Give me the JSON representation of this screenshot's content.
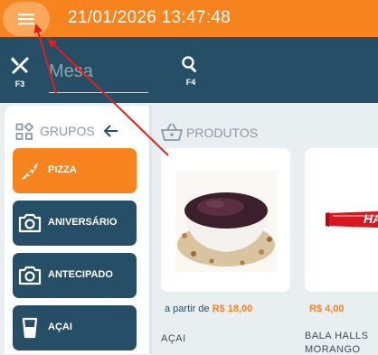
{
  "header": {
    "datetime": "21/01/2026 13:47:48"
  },
  "navbar": {
    "tables_key": "F3",
    "search_key": "F4",
    "mesa_placeholder": "Mesa"
  },
  "groups": {
    "title": "GRUPOS",
    "items": [
      {
        "label": "PIZZA",
        "icon": "pizza-icon",
        "active": true
      },
      {
        "label": "ANIVERSÁRIO",
        "icon": "camera-icon"
      },
      {
        "label": "ANTECIPADO",
        "icon": "camera-icon"
      },
      {
        "label": "AÇAI",
        "icon": "cup-icon"
      }
    ]
  },
  "products": {
    "title": "PRODUTOS",
    "items": [
      {
        "name": "AÇAI",
        "price_prefix": "a partir de",
        "price": "R$ 18,00"
      },
      {
        "name_line1": "BALA HALLS",
        "name_line2": "MORANGO",
        "price": "R$ 4,00",
        "packaging_text": "HA"
      }
    ]
  },
  "colors": {
    "orange": "#f7841e",
    "navy": "#264e66",
    "annotation_red": "#e02020"
  }
}
